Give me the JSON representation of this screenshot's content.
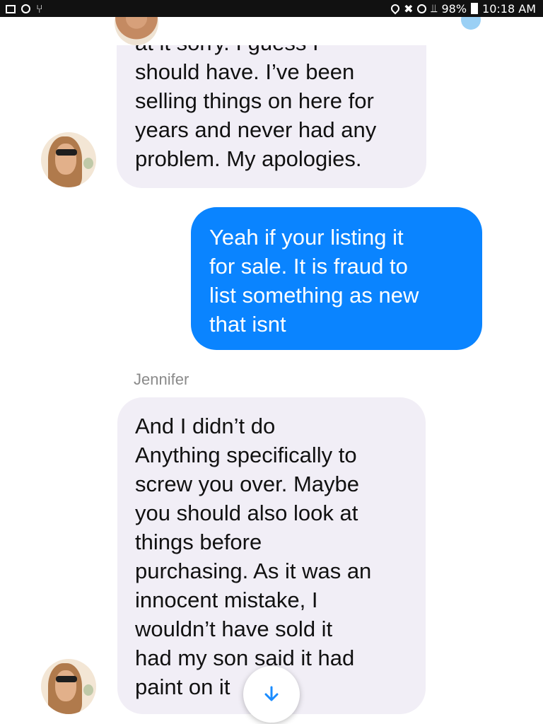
{
  "status_bar": {
    "battery": "98%",
    "time": "10:18 AM",
    "icons": [
      "image-icon",
      "alarm-icon",
      "notification-icon",
      "location-icon",
      "mute-icon",
      "alarm-icon",
      "wifi-icon",
      "battery-icon"
    ]
  },
  "messages": [
    {
      "direction": "incoming",
      "lines": [
        "at it sorry. I guess I",
        "should have. I’ve been",
        "selling things on here for",
        "years and never had any",
        "problem. My apologies."
      ]
    },
    {
      "direction": "outgoing",
      "lines": [
        "Yeah if your listing it",
        "for sale. It is fraud to",
        "list something as new",
        "that isnt"
      ]
    },
    {
      "direction": "incoming",
      "sender": "Jennifer",
      "lines": [
        "And I didn’t do",
        "Anything specifically to",
        "screw you over. Maybe",
        "you should also look at",
        "things before",
        "purchasing. As it was an",
        "innocent mistake, I",
        "wouldn’t have sold it",
        "had my son said it had",
        "paint on it"
      ]
    }
  ],
  "colors": {
    "incoming_bubble": "#f1eef6",
    "outgoing_bubble": "#0a84ff",
    "scroll_arrow": "#1a8cff"
  }
}
